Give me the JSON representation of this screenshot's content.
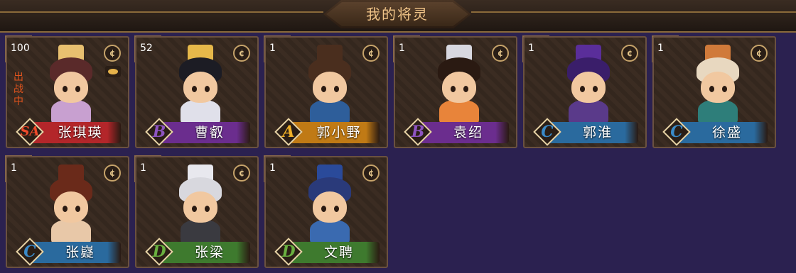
{
  "header": {
    "title": "我的将灵"
  },
  "cards": [
    {
      "name": "张琪瑛",
      "level": "100",
      "grade": "SA",
      "in_battle": "出战中",
      "has_gift": true,
      "bar_color": "#b3262a",
      "grade_color": "#f04a2a",
      "hair": "#5a2a2a",
      "outfit": "#c8a0d0",
      "hat": "#e8c070"
    },
    {
      "name": "曹叡",
      "level": "52",
      "grade": "B",
      "bar_color": "#6b2d8e",
      "grade_color": "#8d54c0",
      "hair": "#1c1c24",
      "outfit": "#e0e0ea",
      "hat": "#e6b84a"
    },
    {
      "name": "郭小野",
      "level": "1",
      "grade": "A",
      "bar_color": "#c07a15",
      "grade_color": "#f0b028",
      "hair": "#4a2e1e",
      "outfit": "#2e5e9a",
      "hat": "#4a2e1e"
    },
    {
      "name": "袁绍",
      "level": "1",
      "grade": "B",
      "bar_color": "#6b2d8e",
      "grade_color": "#8d54c0",
      "hair": "#2a1a12",
      "outfit": "#e8843a",
      "hat": "#d8d8e0"
    },
    {
      "name": "郭淮",
      "level": "1",
      "grade": "C",
      "bar_color": "#2a6a9e",
      "grade_color": "#3a8ac8",
      "hair": "#3a1e6a",
      "outfit": "#5a3a8a",
      "hat": "#5a2e9a"
    },
    {
      "name": "徐盛",
      "level": "1",
      "grade": "C",
      "bar_color": "#2a6a9e",
      "grade_color": "#3a8ac8",
      "hair": "#e8d8c0",
      "outfit": "#2e7e7a",
      "hat": "#d07a3a"
    },
    {
      "name": "张嶷",
      "level": "1",
      "grade": "C",
      "bar_color": "#2a6a9e",
      "grade_color": "#3a8ac8",
      "hair": "#6a2a1a",
      "outfit": "#e8c8a8",
      "hat": "#6a2a1a"
    },
    {
      "name": "张梁",
      "level": "1",
      "grade": "D",
      "bar_color": "#3e7a2e",
      "grade_color": "#6ab040",
      "hair": "#d8d8de",
      "outfit": "#3a3a40",
      "hat": "#e8e8ee"
    },
    {
      "name": "文聘",
      "level": "1",
      "grade": "D",
      "bar_color": "#3e7a2e",
      "grade_color": "#6ab040",
      "hair": "#2a3a7a",
      "outfit": "#3a6ab0",
      "hat": "#2a4a9a"
    }
  ]
}
